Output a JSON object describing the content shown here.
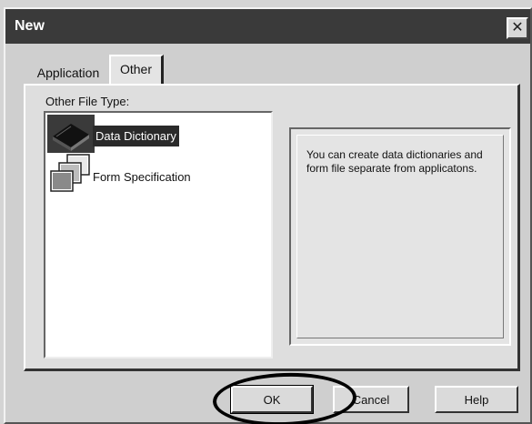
{
  "window": {
    "title": "New",
    "close_glyph": "✕"
  },
  "tabs": [
    {
      "label": "Application",
      "selected": false
    },
    {
      "label": "Other",
      "selected": true
    }
  ],
  "panel": {
    "group_label": "Other File Type:",
    "items": [
      {
        "label": "Data Dictionary",
        "icon": "book-icon",
        "selected": true
      },
      {
        "label": "Form Specification",
        "icon": "stacked-forms-icon",
        "selected": false
      }
    ],
    "description": "You can create data dictionaries and form file separate from applicatons."
  },
  "buttons": {
    "ok": "OK",
    "cancel": "Cancel",
    "help": "Help"
  },
  "colors": {
    "titlebar": "#3a3a3a",
    "selection": "#2a2a2a",
    "dialog_face": "#cfcfcf"
  }
}
